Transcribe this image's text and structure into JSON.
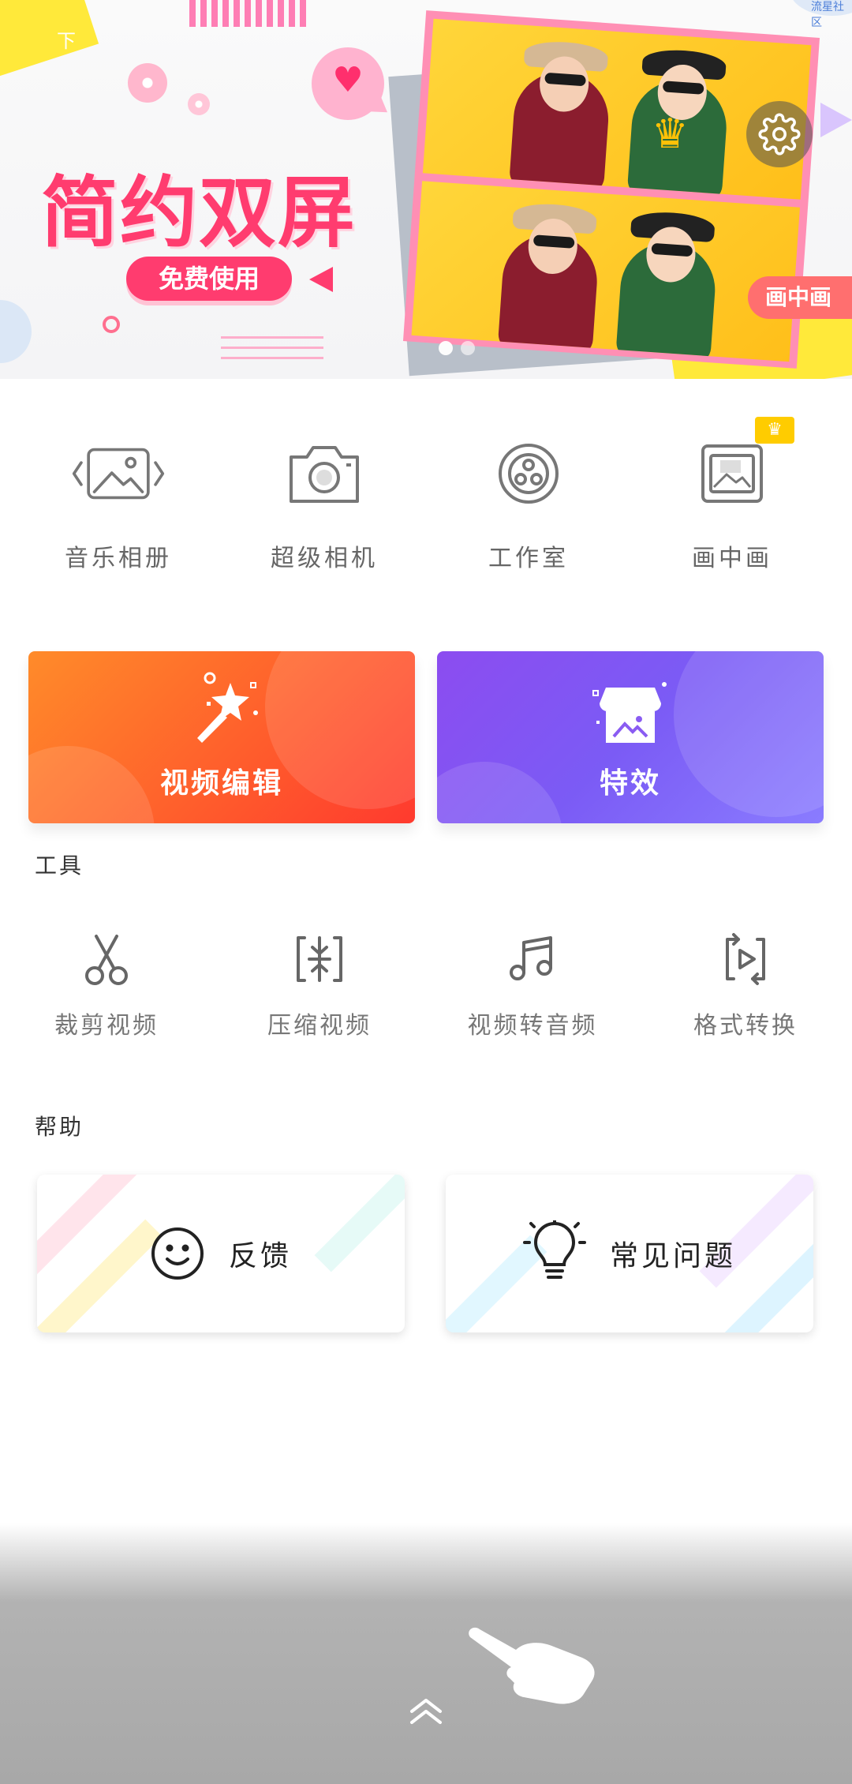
{
  "banner": {
    "title": "简约双屏",
    "free_button": "免费使用",
    "pip_tag": "画中画",
    "status_text": "下",
    "watermark": "流星社区",
    "settings_icon": "gear-icon",
    "crown_icon": "crown-icon",
    "page_count": 2,
    "active_page": 1
  },
  "features": [
    {
      "label": "音乐相册",
      "icon": "photo-album-icon"
    },
    {
      "label": "超级相机",
      "icon": "camera-icon"
    },
    {
      "label": "工作室",
      "icon": "studio-reel-icon"
    },
    {
      "label": "画中画",
      "icon": "picture-in-picture-icon",
      "vip": true
    }
  ],
  "cards": {
    "edit": {
      "label": "视频编辑",
      "icon": "magic-wand-icon",
      "color_start": "#ff8b2a",
      "color_end": "#ff3a2e"
    },
    "fx": {
      "label": "特效",
      "icon": "store-icon",
      "color_start": "#8c4cf0",
      "color_end": "#8a7cff"
    }
  },
  "sections": {
    "tools_title": "工具",
    "help_title": "帮助"
  },
  "tools": [
    {
      "label": "裁剪视频",
      "icon": "scissors-icon"
    },
    {
      "label": "压缩视频",
      "icon": "compress-icon"
    },
    {
      "label": "视频转音频",
      "icon": "music-note-icon"
    },
    {
      "label": "格式转换",
      "icon": "convert-icon"
    }
  ],
  "help": [
    {
      "label": "反馈",
      "icon": "smiley-icon"
    },
    {
      "label": "常见问题",
      "icon": "lightbulb-icon"
    }
  ],
  "colors": {
    "accent_pink": "#ff3c6f",
    "vip_gold": "#ffcc00",
    "label_gray": "#666666"
  }
}
